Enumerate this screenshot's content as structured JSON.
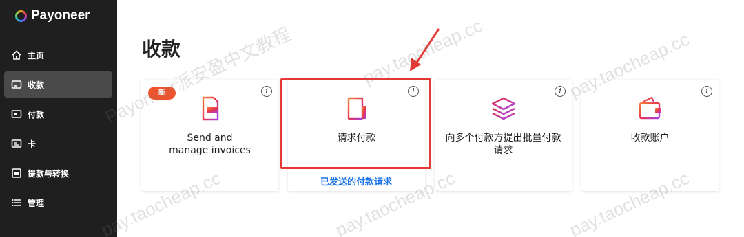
{
  "brand": {
    "name": "Payoneer"
  },
  "sidebar": {
    "items": [
      {
        "label": "主页",
        "icon": "home-icon"
      },
      {
        "label": "收款",
        "icon": "card-icon",
        "active": true
      },
      {
        "label": "付款",
        "icon": "payment-icon"
      },
      {
        "label": "卡",
        "icon": "bankcard-icon"
      },
      {
        "label": "提款与转换",
        "icon": "withdraw-icon"
      },
      {
        "label": "管理",
        "icon": "list-icon"
      }
    ]
  },
  "main": {
    "title": "收款",
    "cards": [
      {
        "label_line1": "Send and",
        "label_line2": "manage invoices",
        "badge": "新",
        "icon": "invoice-icon"
      },
      {
        "label": "请求付款",
        "icon": "request-payment-icon",
        "link": "已发送的付款请求"
      },
      {
        "label_line1": "向多个付款方提出批量付款",
        "label_line2": "请求",
        "icon": "batch-request-icon"
      },
      {
        "label": "收款账户",
        "icon": "wallet-icon"
      }
    ],
    "info_glyph": "i"
  },
  "watermark": {
    "site": "pay.taocheap.cc",
    "text": "Payoneer派安盈中文教程"
  },
  "colors": {
    "sidebar_bg": "#1f1f1f",
    "active_item_bg": "#4a4a4a",
    "badge": "#f0542d",
    "link": "#1a73e8",
    "highlight": "#e53935"
  }
}
